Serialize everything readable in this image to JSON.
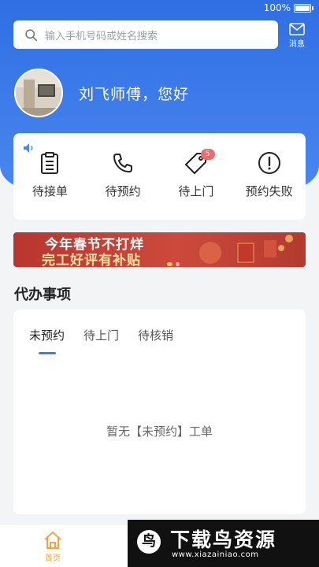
{
  "status": {
    "battery": "100%"
  },
  "search": {
    "placeholder": "输入手机号码或姓名搜索"
  },
  "header": {
    "message_label": "消息",
    "greeting": "刘飞师傅，您好"
  },
  "orders": [
    {
      "label": "待接单",
      "icon": "clipboard-icon"
    },
    {
      "label": "待预约",
      "icon": "phone-icon"
    },
    {
      "label": "待上门",
      "icon": "tag-icon",
      "badge": "5"
    },
    {
      "label": "预约失败",
      "icon": "alert-circle-icon"
    }
  ],
  "banner": {
    "line1": "今年春节不打烊",
    "line2": "完工好评有补贴"
  },
  "todo": {
    "title": "代办事项",
    "tabs": [
      "未预约",
      "待上门",
      "待核销"
    ],
    "active_tab": "未预约",
    "empty_text": "暂无【未预约】工单"
  },
  "tabbar": {
    "home_label": "首页"
  },
  "watermark": {
    "logo": "鸟",
    "title": "下载鸟资源",
    "url": "www.xiazainiao.com"
  },
  "colors": {
    "primary": "#2f6fe3",
    "badge": "#e86d6d",
    "home_active": "#f0a541",
    "tab_indicator": "#3d7fea"
  }
}
